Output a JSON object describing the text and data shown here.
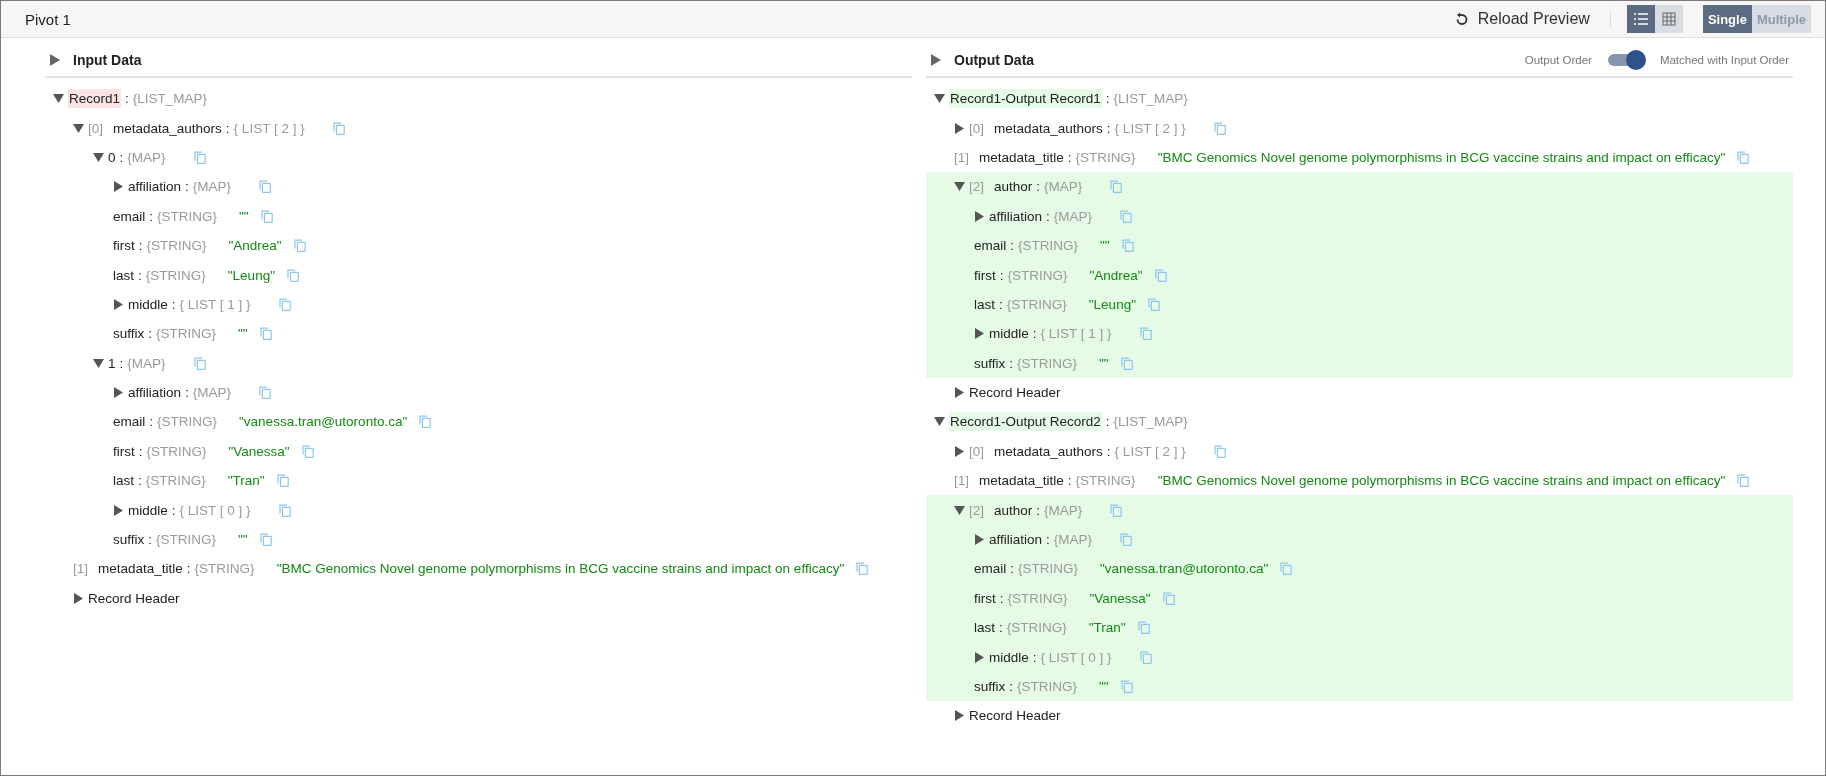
{
  "title": "Pivot 1",
  "toolbar": {
    "reload_label": "Reload Preview",
    "view_modes": [
      {
        "kind": "list",
        "selected": true
      },
      {
        "kind": "grid",
        "selected": false
      }
    ],
    "record_modes": [
      {
        "label": "Single",
        "selected": true
      },
      {
        "label": "Multiple",
        "selected": false
      }
    ]
  },
  "separator": ":",
  "panels": [
    {
      "title": "Input Data",
      "expanded": false,
      "records": [
        {
          "key": "Record1",
          "type": "{LIST_MAP}",
          "expanded": true,
          "copyable": false,
          "color": "#fde4e4",
          "children": [
            {
              "index": "[0]",
              "key": "metadata_authors",
              "type": "{ LIST [ 2 ] }",
              "expanded": true,
              "copyable": true,
              "children": [
                {
                  "key": "0",
                  "type": "{MAP}",
                  "expanded": true,
                  "copyable": true,
                  "children": [
                    {
                      "key": "affiliation",
                      "type": "{MAP}",
                      "expanded": false,
                      "copyable": true
                    },
                    {
                      "key": "email",
                      "type": "{STRING}",
                      "value": "\"\"",
                      "copyable": true
                    },
                    {
                      "key": "first",
                      "type": "{STRING}",
                      "value": "\"Andrea\"",
                      "copyable": true
                    },
                    {
                      "key": "last",
                      "type": "{STRING}",
                      "value": "\"Leung\"",
                      "copyable": true
                    },
                    {
                      "key": "middle",
                      "type": "{ LIST [ 1 ] }",
                      "expanded": false,
                      "copyable": true
                    },
                    {
                      "key": "suffix",
                      "type": "{STRING}",
                      "value": "\"\"",
                      "copyable": true
                    }
                  ]
                },
                {
                  "key": "1",
                  "type": "{MAP}",
                  "expanded": true,
                  "copyable": true,
                  "children": [
                    {
                      "key": "affiliation",
                      "type": "{MAP}",
                      "expanded": false,
                      "copyable": true
                    },
                    {
                      "key": "email",
                      "type": "{STRING}",
                      "value": "\"vanessa.tran@utoronto.ca\"",
                      "copyable": true
                    },
                    {
                      "key": "first",
                      "type": "{STRING}",
                      "value": "\"Vanessa\"",
                      "copyable": true
                    },
                    {
                      "key": "last",
                      "type": "{STRING}",
                      "value": "\"Tran\"",
                      "copyable": true
                    },
                    {
                      "key": "middle",
                      "type": "{ LIST [ 0 ] }",
                      "expanded": false,
                      "copyable": true
                    },
                    {
                      "key": "suffix",
                      "type": "{STRING}",
                      "value": "\"\"",
                      "copyable": true
                    }
                  ]
                }
              ]
            },
            {
              "index": "[1]",
              "key": "metadata_title",
              "type": "{STRING}",
              "value": "\"BMC Genomics Novel genome polymorphisms in BCG vaccine strains and impact on efficacy\"",
              "copyable": true
            },
            {
              "key": "Record Header",
              "expanded": false,
              "copyable": false
            }
          ]
        }
      ]
    },
    {
      "title": "Output Data",
      "expanded": false,
      "order": {
        "label": "Output Order",
        "on": true,
        "value_label": "Matched with Input Order"
      },
      "records": [
        {
          "key": "Record1-Output Record1",
          "type": "{LIST_MAP}",
          "expanded": true,
          "copyable": false,
          "color": "#e6fbe6",
          "children": [
            {
              "index": "[0]",
              "key": "metadata_authors",
              "type": "{ LIST [ 2 ] }",
              "expanded": false,
              "copyable": true
            },
            {
              "index": "[1]",
              "key": "metadata_title",
              "type": "{STRING}",
              "value": "\"BMC Genomics Novel genome polymorphisms in BCG vaccine strains and impact on efficacy\"",
              "copyable": true
            },
            {
              "index": "[2]",
              "key": "author",
              "type": "{MAP}",
              "expanded": true,
              "copyable": true,
              "highlighted": true,
              "children": [
                {
                  "key": "affiliation",
                  "type": "{MAP}",
                  "expanded": false,
                  "copyable": true
                },
                {
                  "key": "email",
                  "type": "{STRING}",
                  "value": "\"\"",
                  "copyable": true
                },
                {
                  "key": "first",
                  "type": "{STRING}",
                  "value": "\"Andrea\"",
                  "copyable": true
                },
                {
                  "key": "last",
                  "type": "{STRING}",
                  "value": "\"Leung\"",
                  "copyable": true
                },
                {
                  "key": "middle",
                  "type": "{ LIST [ 1 ] }",
                  "expanded": false,
                  "copyable": true
                },
                {
                  "key": "suffix",
                  "type": "{STRING}",
                  "value": "\"\"",
                  "copyable": true
                }
              ]
            },
            {
              "key": "Record Header",
              "expanded": false,
              "copyable": false
            }
          ]
        },
        {
          "key": "Record1-Output Record2",
          "type": "{LIST_MAP}",
          "expanded": true,
          "copyable": false,
          "color": "#e6fbe6",
          "children": [
            {
              "index": "[0]",
              "key": "metadata_authors",
              "type": "{ LIST [ 2 ] }",
              "expanded": false,
              "copyable": true
            },
            {
              "index": "[1]",
              "key": "metadata_title",
              "type": "{STRING}",
              "value": "\"BMC Genomics Novel genome polymorphisms in BCG vaccine strains and impact on efficacy\"",
              "copyable": true
            },
            {
              "index": "[2]",
              "key": "author",
              "type": "{MAP}",
              "expanded": true,
              "copyable": true,
              "highlighted": true,
              "children": [
                {
                  "key": "affiliation",
                  "type": "{MAP}",
                  "expanded": false,
                  "copyable": true
                },
                {
                  "key": "email",
                  "type": "{STRING}",
                  "value": "\"vanessa.tran@utoronto.ca\"",
                  "copyable": true
                },
                {
                  "key": "first",
                  "type": "{STRING}",
                  "value": "\"Vanessa\"",
                  "copyable": true
                },
                {
                  "key": "last",
                  "type": "{STRING}",
                  "value": "\"Tran\"",
                  "copyable": true
                },
                {
                  "key": "middle",
                  "type": "{ LIST [ 0 ] }",
                  "expanded": false,
                  "copyable": true
                },
                {
                  "key": "suffix",
                  "type": "{STRING}",
                  "value": "\"\"",
                  "copyable": true
                }
              ]
            },
            {
              "key": "Record Header",
              "expanded": false,
              "copyable": false
            }
          ]
        }
      ]
    }
  ]
}
